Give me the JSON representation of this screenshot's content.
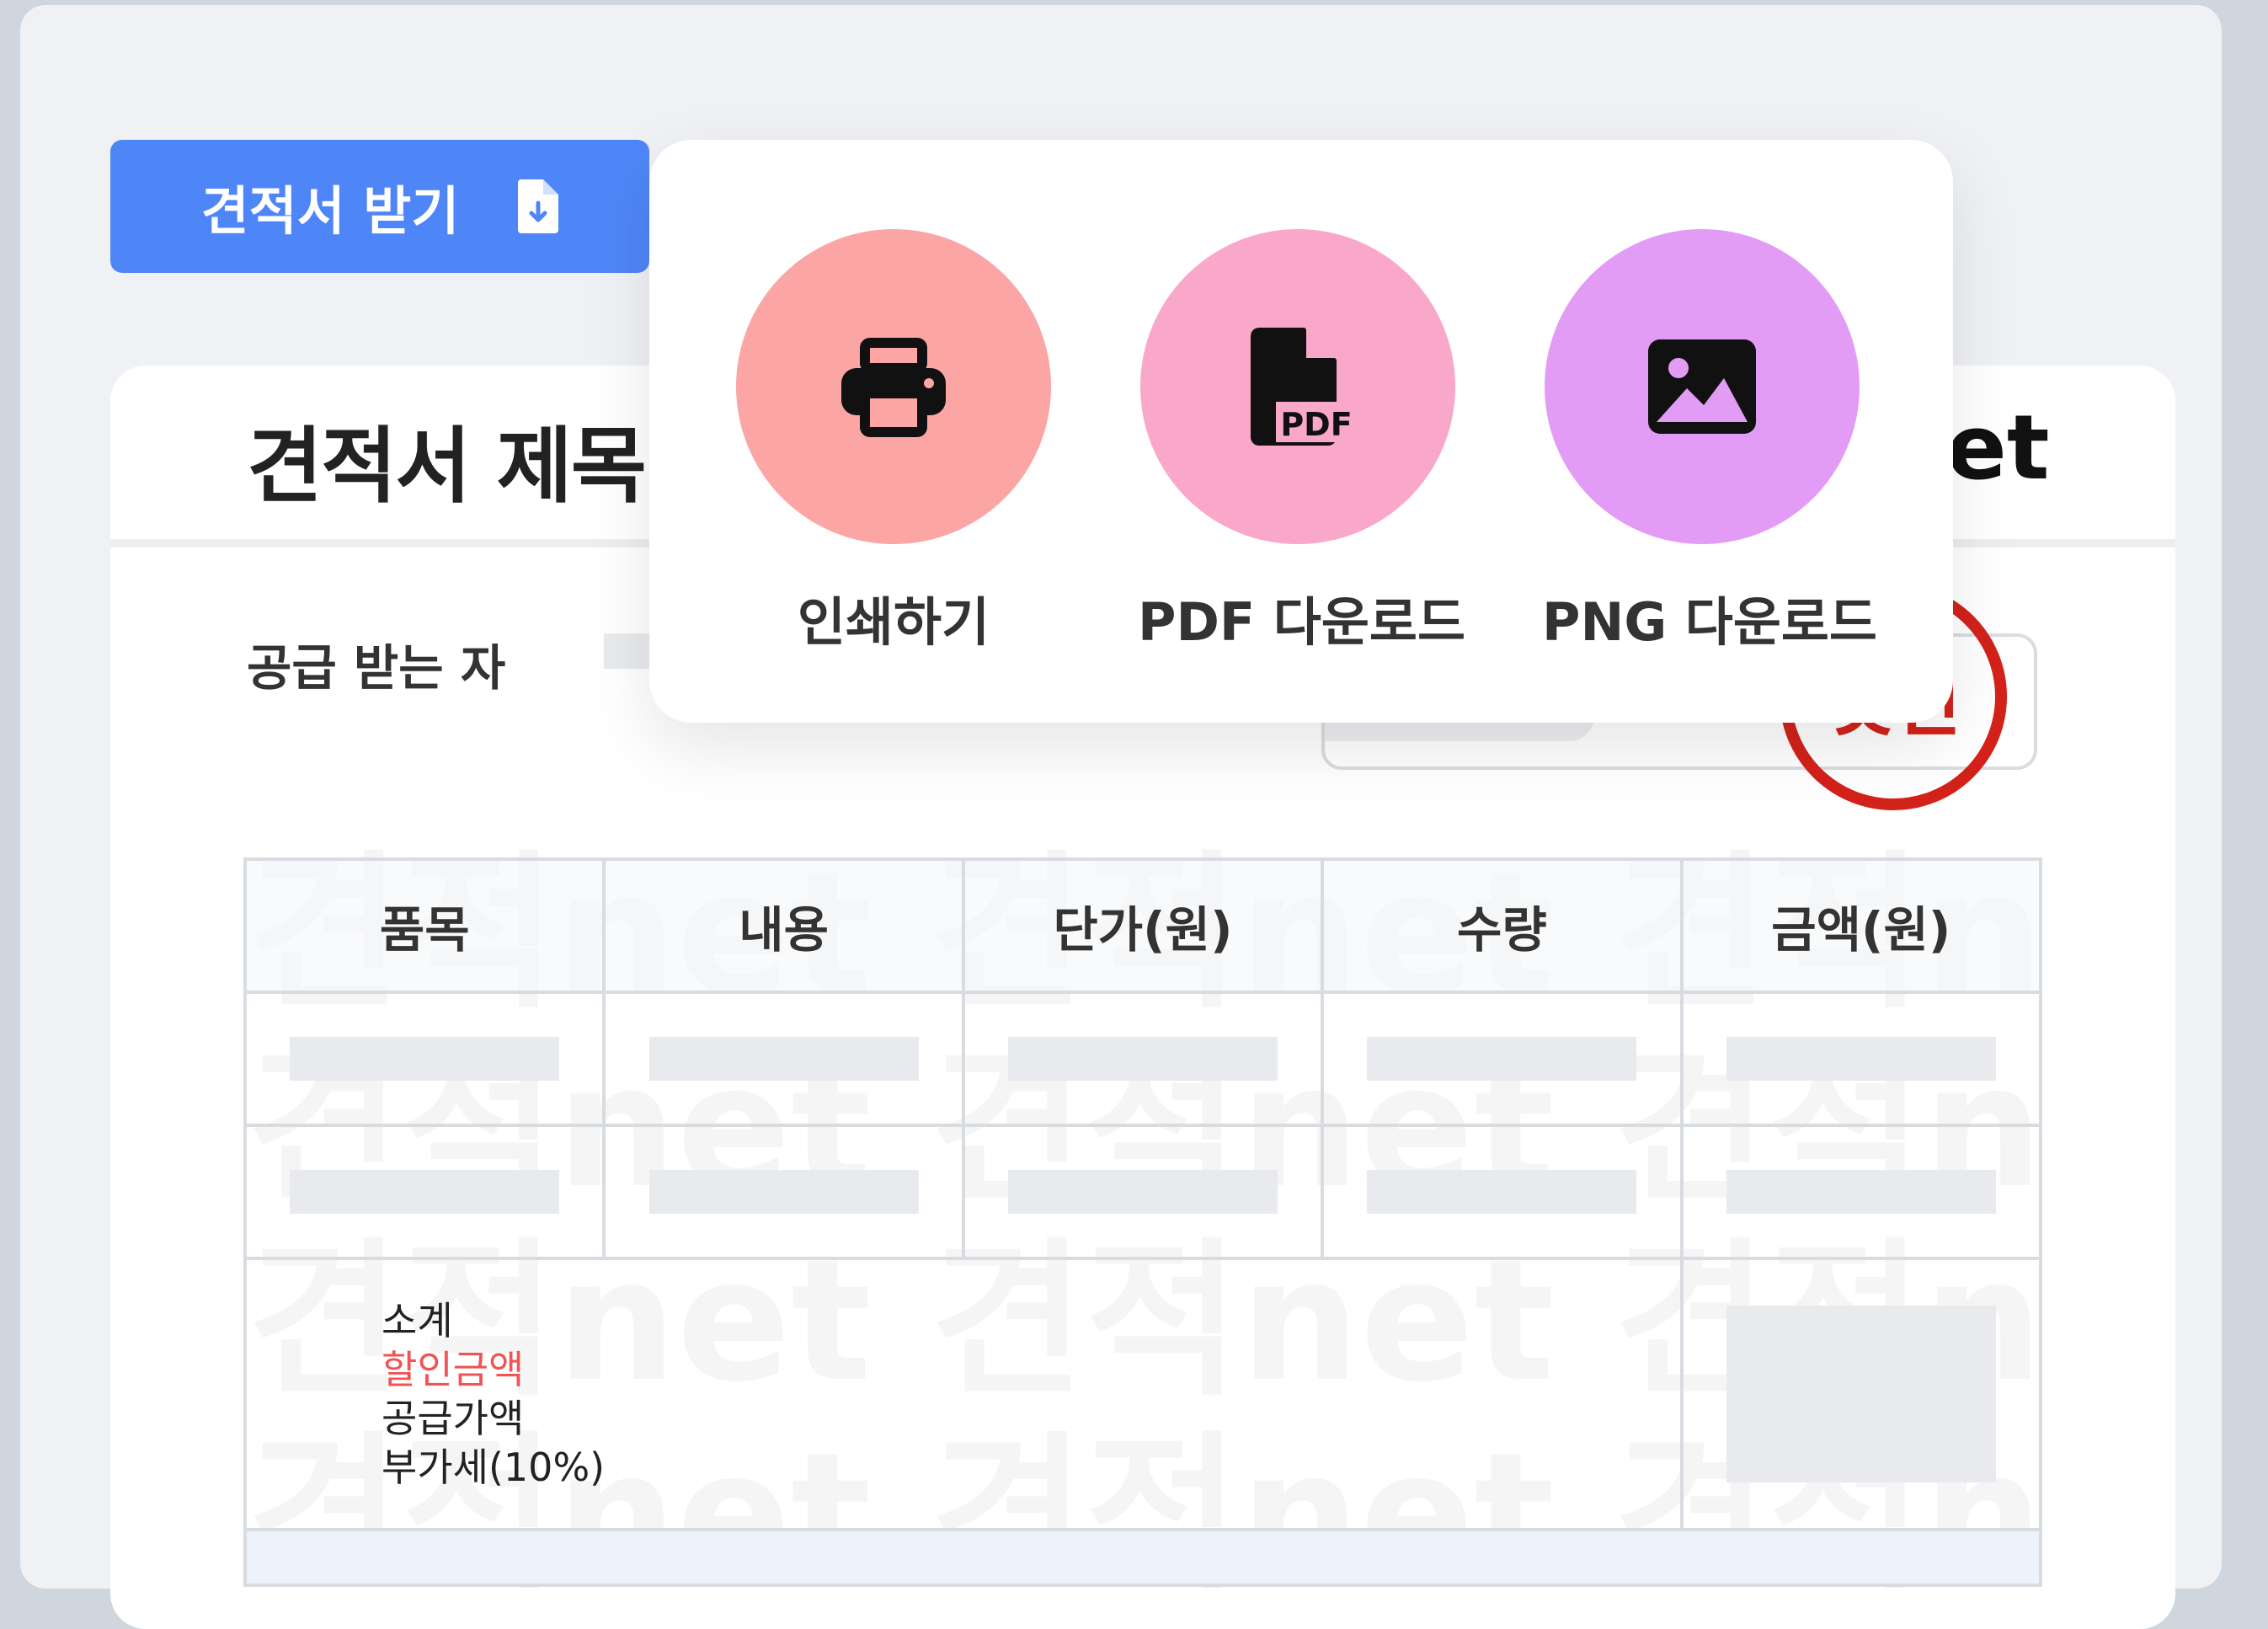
{
  "toolbar": {
    "download_label": "견적서 받기",
    "download_icon": "file-download-icon",
    "accent": "#4f86f7"
  },
  "document": {
    "title": "견적서 제목",
    "brand_suffix": "et",
    "recipient_label": "공급 받는 자",
    "stamp_text": "넷인",
    "watermark_text": "견적net",
    "table": {
      "headers": [
        "품목",
        "내용",
        "단가(원)",
        "수량",
        "금액(원)"
      ],
      "placeholder_rows": 2,
      "summary": {
        "subtotal": "소계",
        "discount": "할인금액",
        "supply": "공급가액",
        "vat": "부가세(10%)"
      }
    }
  },
  "export_menu": {
    "options": [
      {
        "label": "인쇄하기",
        "icon": "printer-icon",
        "color": "#fca5a5"
      },
      {
        "label": "PDF 다운로드",
        "icon": "pdf-file-icon",
        "color": "#f9a8c9"
      },
      {
        "label": "PNG 다운로드",
        "icon": "image-icon",
        "color": "#e29cf5"
      }
    ]
  }
}
